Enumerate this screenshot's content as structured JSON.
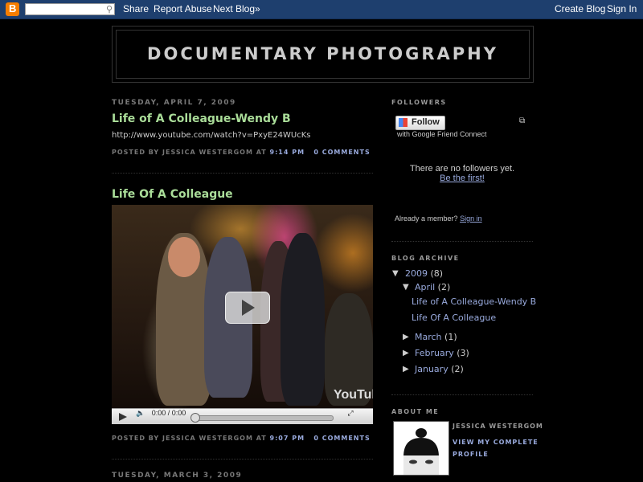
{
  "navbar": {
    "logo_letter": "B",
    "search_placeholder": "",
    "share": "Share",
    "report_abuse": "Report Abuse",
    "next_blog": "Next Blog»",
    "create_blog": "Create Blog",
    "sign_in": "Sign In"
  },
  "header": {
    "title": "DOCUMENTARY PHOTOGRAPHY"
  },
  "posts": [
    {
      "date": "TUESDAY, APRIL 7, 2009",
      "title": "Life of A Colleague-Wendy B",
      "body": "http://www.youtube.com/watch?v=PxyE24WUcKs",
      "posted_by": "POSTED BY JESSICA WESTERGOM AT",
      "time": "9:14 PM",
      "comments": "0 COMMENTS"
    },
    {
      "title": "Life Of A Colleague",
      "video": {
        "time": "0:00 / 0:00",
        "brand": "YouTube",
        "progress": 0
      },
      "posted_by": "POSTED BY JESSICA WESTERGOM AT",
      "time": "9:07 PM",
      "comments": "0 COMMENTS"
    },
    {
      "date": "TUESDAY, MARCH 3, 2009"
    }
  ],
  "sidebar": {
    "followers": {
      "heading": "FOLLOWERS",
      "follow_button": "Follow",
      "gfc": "with Google Friend Connect",
      "none": "There are no followers yet.",
      "be_first": "Be the first!",
      "already_member": "Already a member?",
      "sign_in": "Sign in"
    },
    "archive": {
      "heading": "BLOG ARCHIVE",
      "year": {
        "label": "2009",
        "count": "(8)"
      },
      "april": {
        "label": "April",
        "count": "(2)"
      },
      "april_posts": [
        "Life of A Colleague-Wendy B",
        "Life Of A Colleague"
      ],
      "months": [
        {
          "label": "March",
          "count": "(1)"
        },
        {
          "label": "February",
          "count": "(3)"
        },
        {
          "label": "January",
          "count": "(2)"
        }
      ]
    },
    "about": {
      "heading": "ABOUT ME",
      "name": "JESSICA WESTERGOM",
      "profile_line1": "VIEW MY COMPLETE",
      "profile_line2": "PROFILE"
    }
  },
  "colors": {
    "link": "#99aadd",
    "title": "#aadd99",
    "navbar": "#1e3f6e",
    "background": "#000000"
  }
}
